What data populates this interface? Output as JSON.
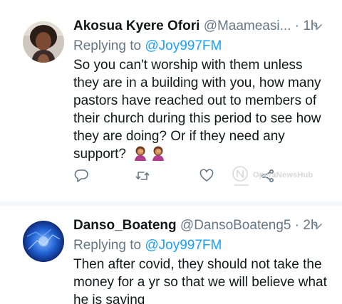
{
  "tweets": [
    {
      "name": "Akosua Kyere Ofori",
      "handle": "@Maameasi...",
      "time": "· 1h",
      "replying_prefix": "Replying to ",
      "replying_to": "@Joy997FM",
      "text": "So you can't worship with them unless they are in a building with you, how many pastors have reached out to members of their church during this period to see how they are doing? Or if they need any support?",
      "emojis": [
        "woman-facepalming-emoji",
        "woman-facepalming-emoji"
      ]
    },
    {
      "name": "Danso_Boateng",
      "handle": "@DansoBoateng5",
      "time": "· 2h",
      "replying_prefix": "Replying to ",
      "replying_to": "@Joy997FM",
      "text": "Then after covid, they should not take the money for a yr so that we will believe what he is saying"
    }
  ],
  "actions": [
    "reply-icon",
    "retweet-icon",
    "like-icon",
    "share-icon"
  ],
  "watermark": "OperaNewsHub",
  "colors": {
    "link": "#1da1f2",
    "muted": "#657786",
    "text": "#14171a"
  }
}
